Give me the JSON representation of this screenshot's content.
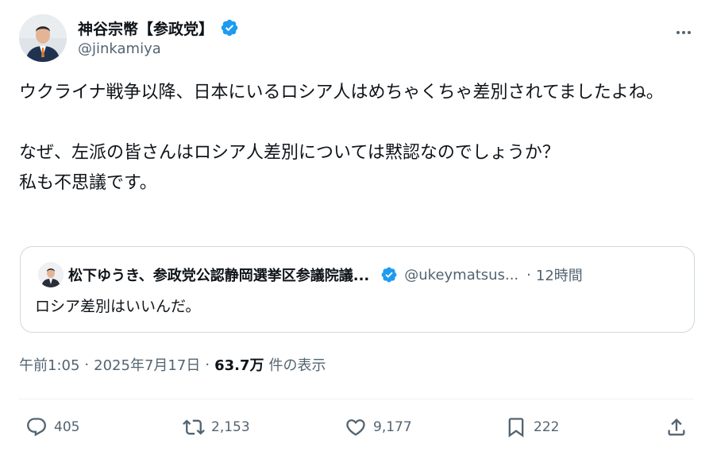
{
  "author": {
    "display_name": "神谷宗幣【参政党】",
    "handle": "@jinkamiya",
    "verified_icon": "verified-badge-icon",
    "avatar_icon": "profile-photo"
  },
  "more_icon": "more-options-icon",
  "tweet": {
    "text": "ウクライナ戦争以降、日本にいるロシア人はめちゃくちゃ差別されてましたよね。\n\nなぜ、左派の皆さんはロシア人差別については黙認なのでしょうか？\n私も不思議です。"
  },
  "quote": {
    "display_name": "松下ゆうき、参政党公認静岡選挙区参議院議...",
    "handle": "@ukeymatsus...",
    "separator": "·",
    "time": "12時間",
    "text": "ロシア差別はいいんだ。"
  },
  "meta": {
    "time": "午前1:05",
    "sep1": "·",
    "date": "2025年7月17日",
    "sep2": "·",
    "views": "63.7万",
    "views_label": "件の表示"
  },
  "actions": {
    "reply_count": "405",
    "retweet_count": "2,153",
    "like_count": "9,177",
    "bookmark_count": "222"
  },
  "colors": {
    "verified": "#1d9bf0",
    "secondary_text": "#536471",
    "primary_text": "#0f1419",
    "border": "#cfd9de"
  }
}
